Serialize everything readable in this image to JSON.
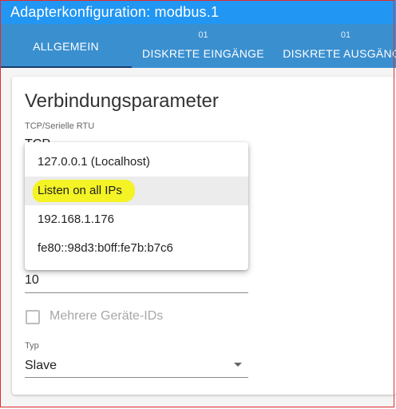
{
  "window": {
    "title": "Adapterkonfiguration: modbus.1"
  },
  "tabs": [
    {
      "label": "ALLGEMEIN",
      "count": ""
    },
    {
      "label": "DISKRETE EINGÄNGE",
      "count": "01"
    },
    {
      "label": "DISKRETE AUSGÄNGE",
      "count": "01"
    }
  ],
  "section": {
    "title": "Verbindungsparameter"
  },
  "connection": {
    "label": "TCP/Serielle RTU",
    "value": "TCP"
  },
  "bind_menu": {
    "items": [
      "127.0.0.1 (Localhost)",
      "Listen on all IPs",
      "192.168.1.176",
      "fe80::98d3:b0ff:fe7b:b7c6"
    ],
    "highlighted_index": 1
  },
  "device_id": {
    "value": "10"
  },
  "multiple_ids": {
    "label": "Mehrere Geräte-IDs",
    "checked": false
  },
  "type": {
    "label": "Typ",
    "value": "Slave"
  },
  "colors": {
    "titlebar": "#2196f3",
    "tabs": "#3a8fcf",
    "highlight": "#f3f31a",
    "border": "#e52b2b"
  }
}
